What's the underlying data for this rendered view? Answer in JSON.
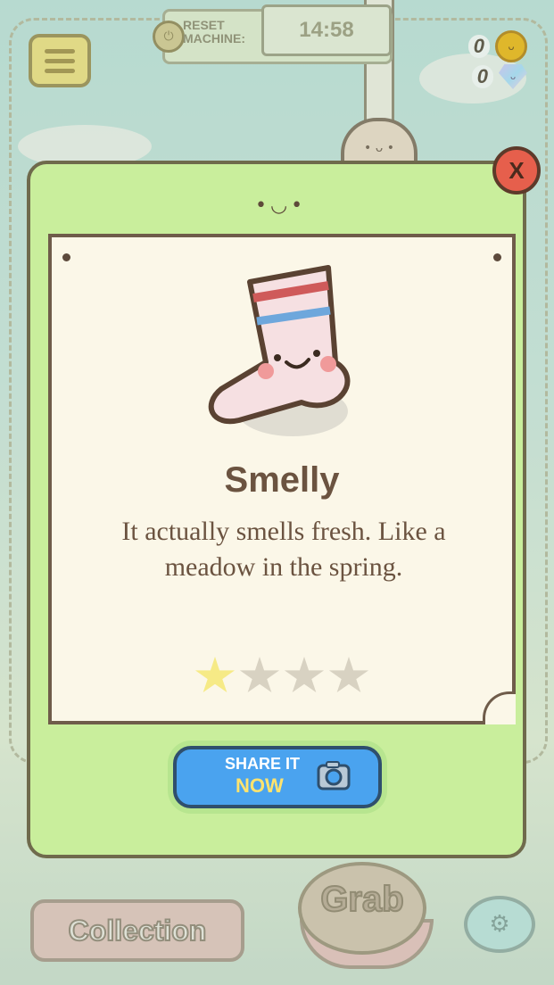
{
  "header": {
    "reset_label_line1": "RESET",
    "reset_label_line2": "MACHINE:",
    "timer": "14:58"
  },
  "currencies": {
    "coins": "0",
    "gems": "0"
  },
  "bottom": {
    "collection_label": "Collection",
    "grab_label": "Grab"
  },
  "modal": {
    "close_label": "X",
    "item_name": "Smelly",
    "item_description": "It actually smells fresh. Like a meadow in the spring.",
    "rating": 1,
    "rating_max": 4,
    "share_line1": "SHARE IT",
    "share_line2": "NOW"
  },
  "colors": {
    "modal_bg": "#c9ee9c",
    "card_bg": "#fbf7e8",
    "share_button": "#4aa3ef",
    "close_button": "#e65f4c"
  },
  "icons": [
    "menu-icon",
    "reset-icon",
    "coin-icon",
    "gem-icon",
    "close-icon",
    "sock-icon",
    "star-icon",
    "camera-icon",
    "gear-icon"
  ]
}
